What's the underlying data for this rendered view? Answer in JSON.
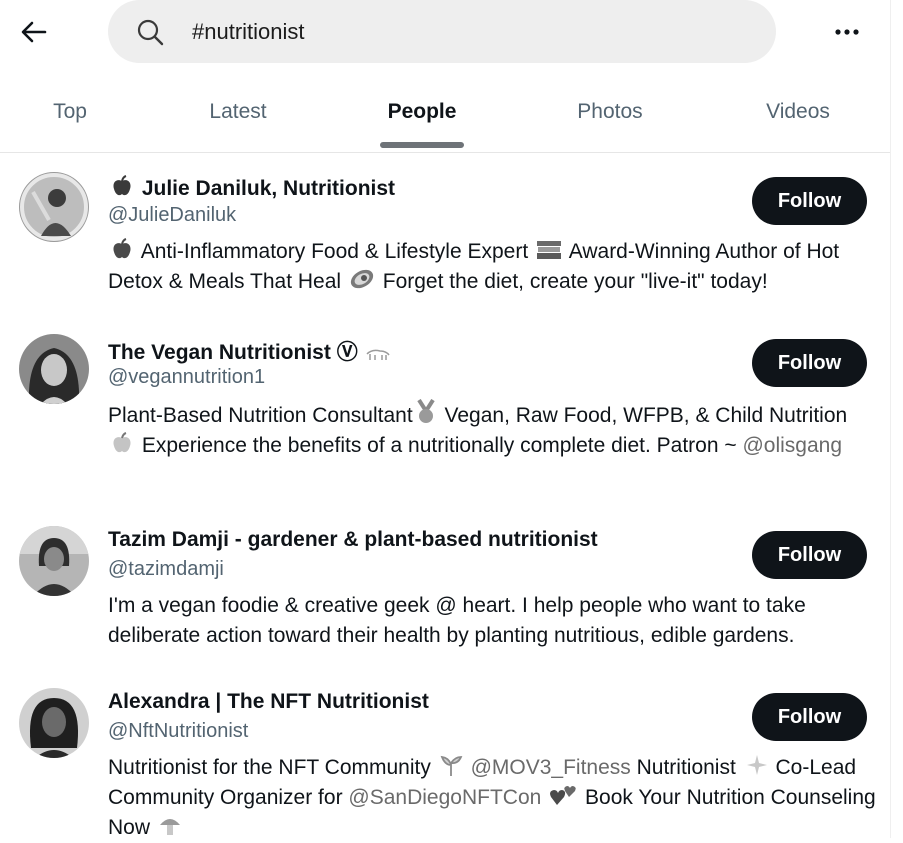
{
  "search": {
    "query": "#nutritionist"
  },
  "tabs": [
    {
      "label": "Top"
    },
    {
      "label": "Latest"
    },
    {
      "label": "People"
    },
    {
      "label": "Photos"
    },
    {
      "label": "Videos"
    }
  ],
  "active_tab": "People",
  "users": [
    {
      "name": "Julie Daniluk, Nutritionist",
      "handle": "@JulieDaniluk",
      "follow_label": "Follow",
      "bio": [
        {
          "t": "Anti-Inflammatory Food & Lifestyle Expert"
        },
        {
          "t": "Award-Winning Author of Hot Detox & Meals That Heal"
        },
        {
          "t": "Forget the diet, create your \"live-it\" today!"
        }
      ]
    },
    {
      "name": "The Vegan Nutritionist",
      "name_suffix": "Ⓥ",
      "handle": "@vegannutrition1",
      "follow_label": "Follow",
      "bio": [
        {
          "t": "Plant-Based Nutrition Consultant"
        },
        {
          "t": "Vegan, Raw Food, WFPB, & Child Nutrition"
        },
        {
          "t": "Experience the benefits of a nutritionally complete diet. Patron ~"
        },
        {
          "m": "@olisgang"
        }
      ]
    },
    {
      "name": "Tazim Damji - gardener & plant-based nutritionist",
      "handle": "@tazimdamji",
      "follow_label": "Follow",
      "bio": [
        {
          "t": "I'm a vegan foodie & creative geek @ heart. I help people who want to take deliberate action toward their health by planting nutritious, edible gardens."
        }
      ]
    },
    {
      "name": "Alexandra | The NFT Nutritionist",
      "handle": "@NftNutritionist",
      "follow_label": "Follow",
      "bio": [
        {
          "t": "Nutritionist for the NFT Community"
        },
        {
          "m": "@MOV3_Fitness"
        },
        {
          "t": "Nutritionist"
        },
        {
          "t": "Co-Lead Community Organizer for"
        },
        {
          "m": "@SanDiegoNFTCon"
        },
        {
          "t": "Book Your Nutrition Counseling Now"
        }
      ]
    }
  ]
}
